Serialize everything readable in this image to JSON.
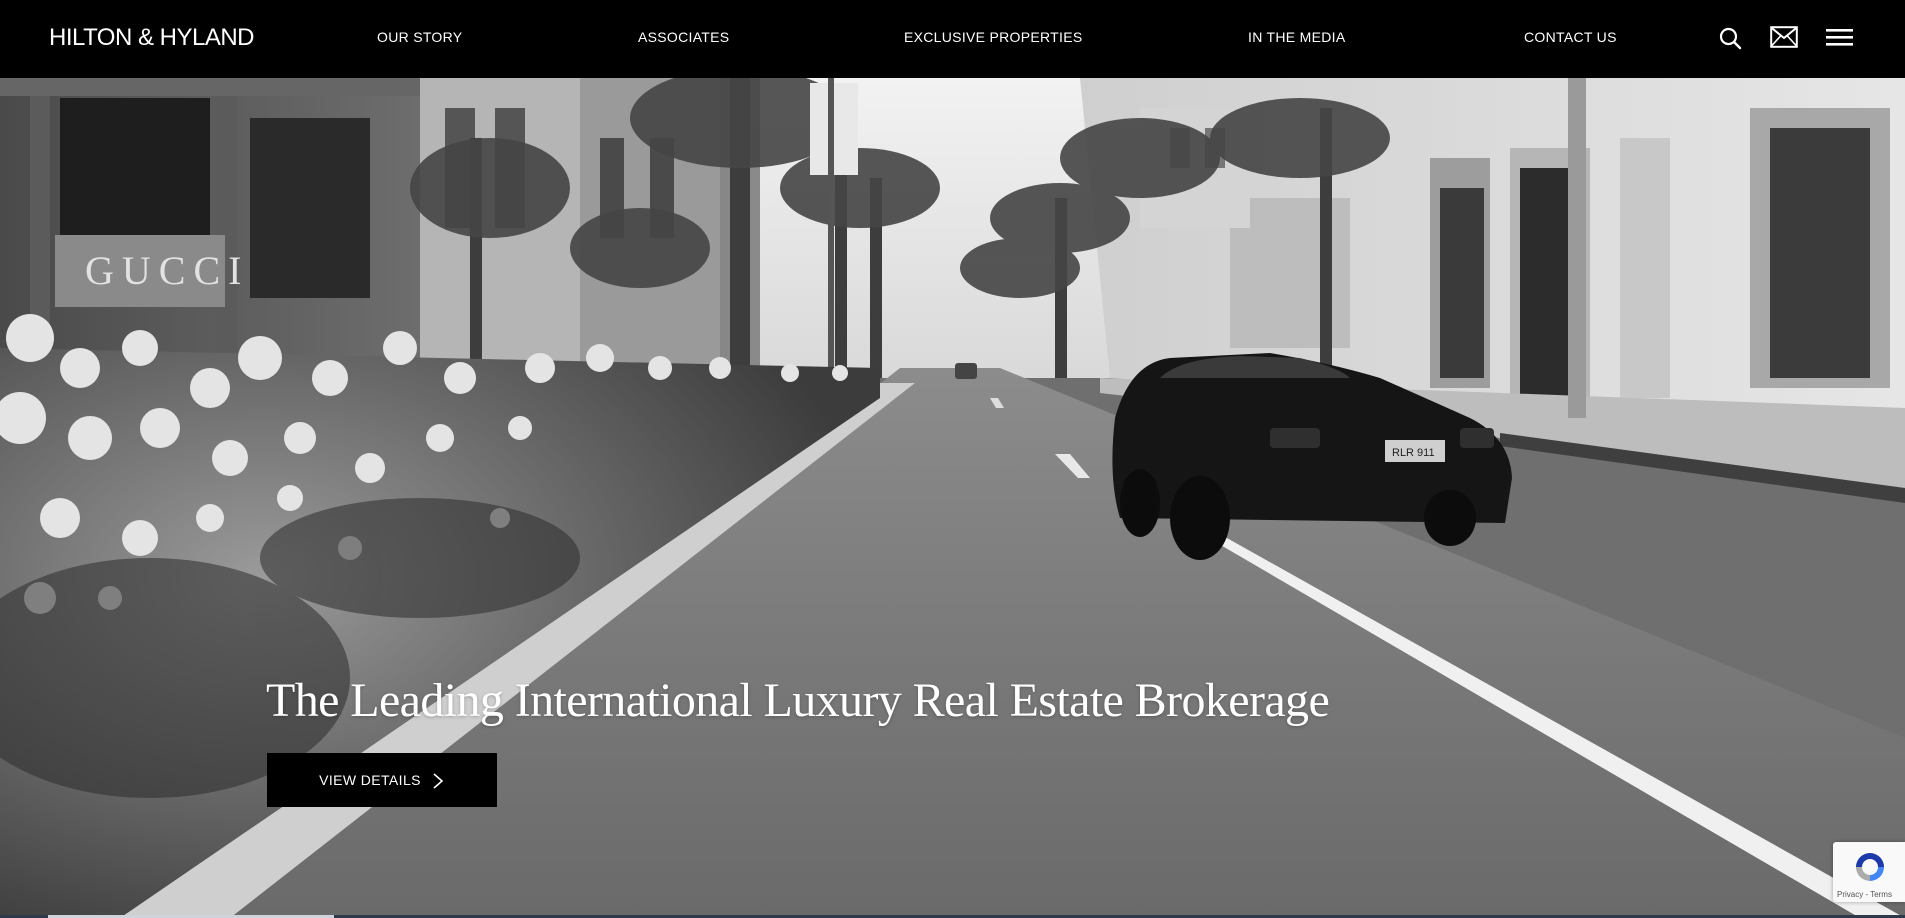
{
  "header": {
    "logo": "HILTON & HYLAND",
    "nav": [
      {
        "label": "OUR STORY"
      },
      {
        "label": "ASSOCIATES"
      },
      {
        "label": "EXCLUSIVE PROPERTIES"
      },
      {
        "label": "IN THE MEDIA"
      },
      {
        "label": "CONTACT US"
      }
    ],
    "icons": [
      "search-icon",
      "mail-icon",
      "menu-icon"
    ]
  },
  "hero": {
    "headline": "The Leading International Luxury Real Estate Brokerage",
    "cta_label": "VIEW DETAILS",
    "storefront_sign": "GUCCI",
    "plate": "RLR 911"
  },
  "recaptcha": {
    "links": "Privacy - Terms"
  },
  "colors": {
    "header_bg": "#000000",
    "text": "#ffffff",
    "button_bg": "#000000"
  }
}
